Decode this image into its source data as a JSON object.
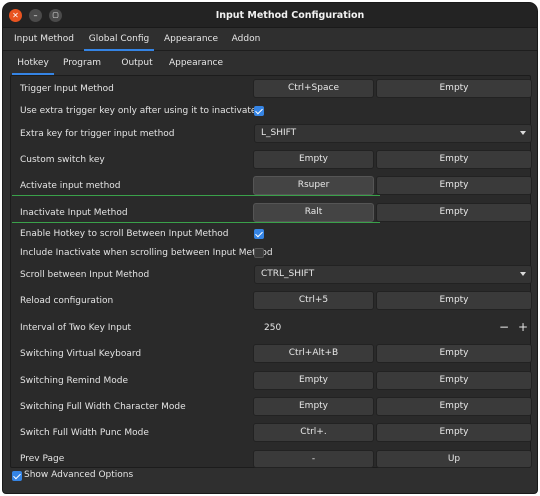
{
  "window": {
    "title": "Input Method Configuration",
    "close_glyph": "✕",
    "minimize_glyph": "–",
    "maximize_glyph": "▢"
  },
  "main_tabs": [
    {
      "label": "Input Method"
    },
    {
      "label": "Global Config"
    },
    {
      "label": "Appearance"
    },
    {
      "label": "Addon"
    }
  ],
  "sub_tabs": [
    {
      "label": "Hotkey"
    },
    {
      "label": "Program"
    },
    {
      "label": "Output"
    },
    {
      "label": "Appearance"
    }
  ],
  "rows": {
    "trigger": {
      "label": "Trigger Input Method",
      "key1": "Ctrl+Space",
      "key2": "Empty"
    },
    "extra_trigger_only": {
      "label": "Use extra trigger key only after using it to inactivate",
      "checked": true
    },
    "extra_key": {
      "label": "Extra key for trigger input method",
      "value": "L_SHIFT"
    },
    "custom_switch": {
      "label": "Custom switch key",
      "key1": "Empty",
      "key2": "Empty"
    },
    "activate": {
      "label": "Activate input method",
      "key1": "Rsuper",
      "key2": "Empty"
    },
    "inactivate": {
      "label": "Inactivate Input Method",
      "key1": "Ralt",
      "key2": "Empty"
    },
    "enable_scroll": {
      "label": "Enable Hotkey to scroll Between Input Method",
      "checked": true
    },
    "include_inactivate": {
      "label": "Include Inactivate when scrolling between Input Method",
      "checked": false
    },
    "scroll_between": {
      "label": "Scroll between Input Method",
      "value": "CTRL_SHIFT"
    },
    "reload": {
      "label": "Reload configuration",
      "key1": "Ctrl+5",
      "key2": "Empty"
    },
    "interval": {
      "label": "Interval of Two Key Input",
      "value": "250",
      "minus": "−",
      "plus": "+"
    },
    "virtual_keyboard": {
      "label": "Switching Virtual Keyboard",
      "key1": "Ctrl+Alt+B",
      "key2": "Empty"
    },
    "remind_mode": {
      "label": "Switching Remind Mode",
      "key1": "Empty",
      "key2": "Empty"
    },
    "full_width_char": {
      "label": "Switching Full Width Character Mode",
      "key1": "Empty",
      "key2": "Empty"
    },
    "full_width_punc": {
      "label": "Switch Full Width Punc Mode",
      "key1": "Ctrl+.",
      "key2": "Empty"
    },
    "prev_page": {
      "label": "Prev Page",
      "key1": "-",
      "key2": "Up"
    }
  },
  "footer": {
    "show_advanced_label": "Show Advanced Options",
    "checked": true
  },
  "colors": {
    "accent": "#3584e4",
    "focus_line": "#3aa14a",
    "close_button": "#e95420"
  }
}
